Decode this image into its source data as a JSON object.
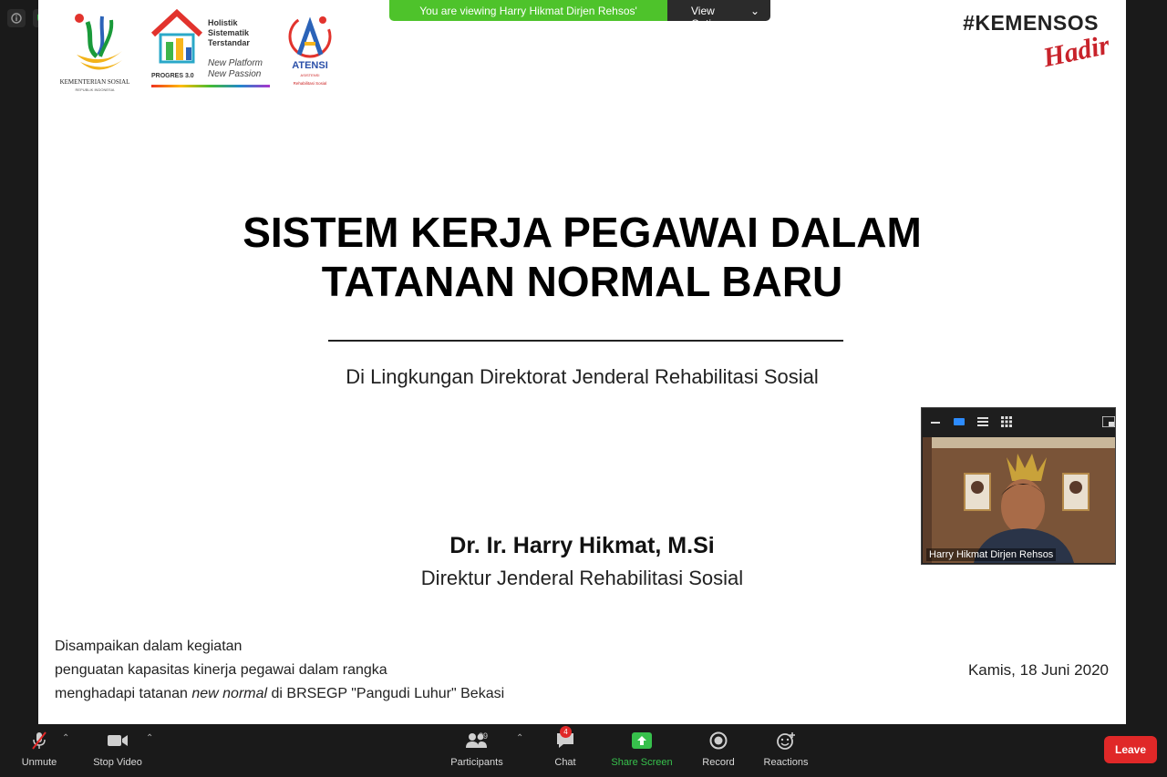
{
  "banner": {
    "viewing_text": "You are viewing Harry Hikmat Dirjen Rehsos' screen",
    "view_options": "View Options"
  },
  "logos": {
    "kemsos_caption": "KEMENTERIAN SOSIAL",
    "kemsos_sub": "REPUBLIK INDONESIA",
    "progres_label": "PROGRES 3.0",
    "progres_lines": "Holistik Sistematik Terstandar",
    "progres_tagline": "New Platform New Passion",
    "atensi_label": "ATENSI",
    "atensi_sub": "ASISTENSI",
    "atensi_sub2": "Rehabilitasi Sosial"
  },
  "hashtag": "#KEMENSOS",
  "hashtag_script": "Hadir",
  "slide": {
    "title_line1": "SISTEM KERJA PEGAWAI DALAM",
    "title_line2": "TATANAN NORMAL BARU",
    "subtitle": "Di Lingkungan Direktorat Jenderal Rehabilitasi Sosial",
    "speaker_name": "Dr. Ir. Harry Hikmat, M.Si",
    "speaker_role": "Direktur Jenderal Rehabilitasi Sosial",
    "note_line1": "Disampaikan dalam kegiatan",
    "note_line2": "penguatan kapasitas kinerja pegawai dalam rangka",
    "note_line3_pre": "menghadapi tatanan ",
    "note_line3_em": "new normal",
    "note_line3_post": " di BRSEGP \"Pangudi Luhur\" Bekasi",
    "date": "Kamis, 18 Juni 2020"
  },
  "thumbnail": {
    "participant_name": "Harry Hikmat Dirjen Rehsos"
  },
  "toolbar": {
    "unmute": "Unmute",
    "stop_video": "Stop Video",
    "participants": "Participants",
    "participants_count": "39",
    "chat": "Chat",
    "chat_badge": "4",
    "share_screen": "Share Screen",
    "record": "Record",
    "reactions": "Reactions",
    "leave": "Leave"
  },
  "colors": {
    "banner_green": "#4ec32b",
    "leave_red": "#e02828",
    "share_green": "#37c04c",
    "brand_red": "#c8222a"
  }
}
